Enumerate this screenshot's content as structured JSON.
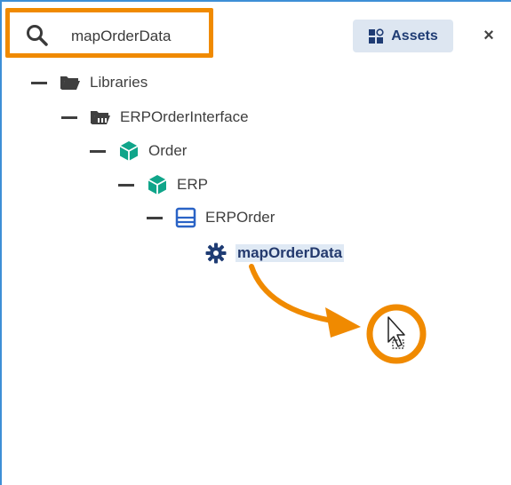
{
  "search": {
    "value": "mapOrderData"
  },
  "toolbar": {
    "assets_label": "Assets",
    "close_label": "×"
  },
  "tree": {
    "items": [
      {
        "label": "Libraries"
      },
      {
        "label": "ERPOrderInterface"
      },
      {
        "label": "Order"
      },
      {
        "label": "ERP"
      },
      {
        "label": "ERPOrder"
      },
      {
        "label": "mapOrderData"
      }
    ]
  },
  "colors": {
    "accent": "#f08a00",
    "border": "#3d8fd6",
    "package": "#10a58a",
    "class": "#2a63c6",
    "selection": "#dfe9f4"
  }
}
